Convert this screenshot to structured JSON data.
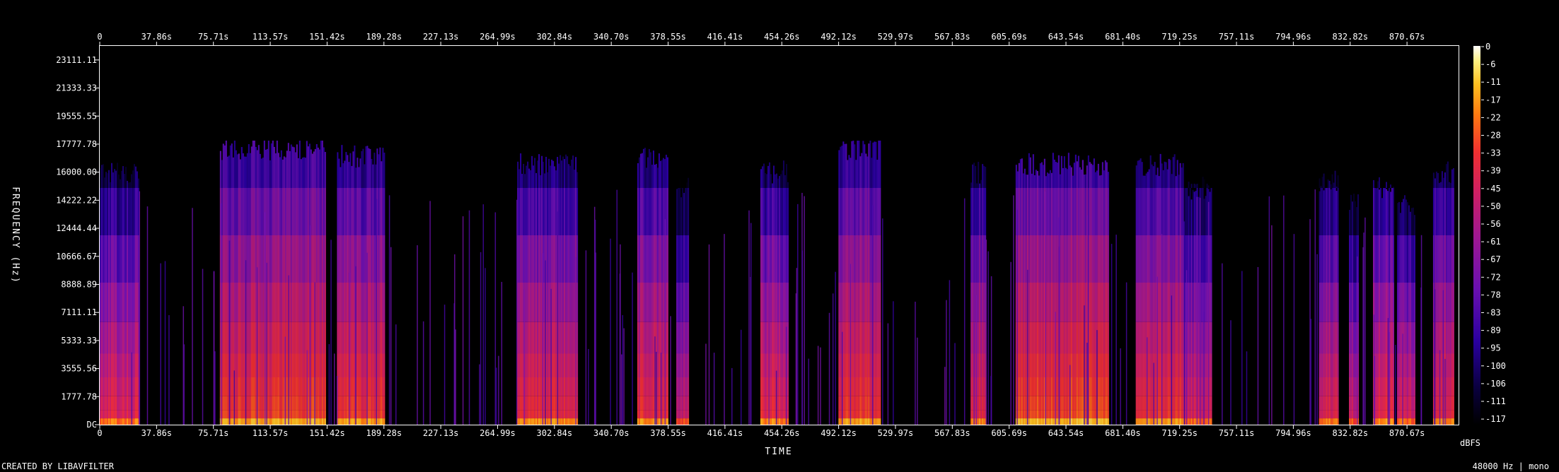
{
  "chart_data": {
    "type": "heatmap",
    "title": "",
    "xlabel": "TIME",
    "ylabel": "FREQUENCY (Hz)",
    "x_ticks": [
      "0",
      "37.86s",
      "75.71s",
      "113.57s",
      "151.42s",
      "189.28s",
      "227.13s",
      "264.99s",
      "302.84s",
      "340.70s",
      "378.55s",
      "416.41s",
      "454.26s",
      "492.12s",
      "529.97s",
      "567.83s",
      "605.69s",
      "643.54s",
      "681.40s",
      "719.25s",
      "757.11s",
      "794.96s",
      "832.82s",
      "870.67s"
    ],
    "xlim": [
      0,
      905
    ],
    "y_ticks": [
      "23111.11",
      "21333.33",
      "19555.55",
      "17777.78",
      "16000.00",
      "14222.22",
      "12444.44",
      "10666.67",
      "8888.89",
      "7111.11",
      "5333.33",
      "3555.56",
      "1777.78",
      "DC"
    ],
    "y_tick_values": [
      23111.11,
      21333.33,
      19555.55,
      17777.78,
      16000.0,
      14222.22,
      12444.44,
      10666.67,
      8888.89,
      7111.11,
      5333.33,
      3555.56,
      1777.78,
      0
    ],
    "ylim": [
      0,
      24000
    ],
    "colorbar": {
      "label": "dBFS",
      "ticks": [
        "0",
        "-6",
        "-11",
        "-17",
        "-22",
        "-28",
        "-33",
        "-39",
        "-45",
        "-50",
        "-56",
        "-61",
        "-67",
        "-72",
        "-78",
        "-83",
        "-89",
        "-95",
        "-100",
        "-106",
        "-111",
        "-117"
      ],
      "range": [
        -120,
        0
      ],
      "colors": [
        "#000000",
        "#0a0040",
        "#2a00a0",
        "#6a10b0",
        "#a01890",
        "#d02060",
        "#f03030",
        "#ff7a10",
        "#ffc020",
        "#fff080",
        "#ffffff"
      ]
    },
    "segments": [
      {
        "start": 0,
        "end": 26,
        "level": -55,
        "cutoff": 16000
      },
      {
        "start": 80,
        "end": 150,
        "level": -45,
        "cutoff": 17500
      },
      {
        "start": 158,
        "end": 190,
        "level": -47,
        "cutoff": 17000
      },
      {
        "start": 278,
        "end": 318,
        "level": -50,
        "cutoff": 16500
      },
      {
        "start": 358,
        "end": 378,
        "level": -50,
        "cutoff": 17000
      },
      {
        "start": 384,
        "end": 392,
        "level": -58,
        "cutoff": 15000
      },
      {
        "start": 440,
        "end": 458,
        "level": -52,
        "cutoff": 16000
      },
      {
        "start": 492,
        "end": 520,
        "level": -47,
        "cutoff": 17500
      },
      {
        "start": 580,
        "end": 590,
        "level": -52,
        "cutoff": 16000
      },
      {
        "start": 610,
        "end": 672,
        "level": -42,
        "cutoff": 16500
      },
      {
        "start": 690,
        "end": 722,
        "level": -48,
        "cutoff": 16500
      },
      {
        "start": 722,
        "end": 740,
        "level": -58,
        "cutoff": 15000
      },
      {
        "start": 812,
        "end": 825,
        "level": -55,
        "cutoff": 15500
      },
      {
        "start": 832,
        "end": 838,
        "level": -60,
        "cutoff": 14000
      },
      {
        "start": 848,
        "end": 862,
        "level": -52,
        "cutoff": 15000
      },
      {
        "start": 864,
        "end": 876,
        "level": -58,
        "cutoff": 14000
      },
      {
        "start": 888,
        "end": 902,
        "level": -52,
        "cutoff": 16000
      }
    ]
  },
  "footer": {
    "left": "CREATED BY LIBAVFILTER",
    "right": "48000 Hz | mono"
  }
}
